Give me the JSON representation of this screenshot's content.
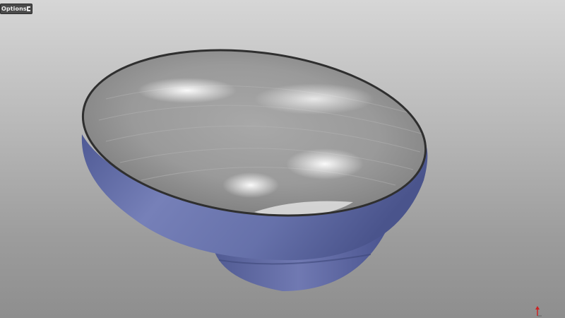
{
  "toolbar": {
    "options_label": "Options",
    "pin_icon": "pin-icon"
  },
  "viewport": {
    "object": "bowl-model",
    "colors": {
      "exterior": "#6a75ad",
      "interior": "#9a9a9a",
      "rim": "#2f2f2f",
      "axis_x": "#cc2222"
    }
  },
  "axis_triad": {
    "icon": "axis-triad-icon"
  }
}
